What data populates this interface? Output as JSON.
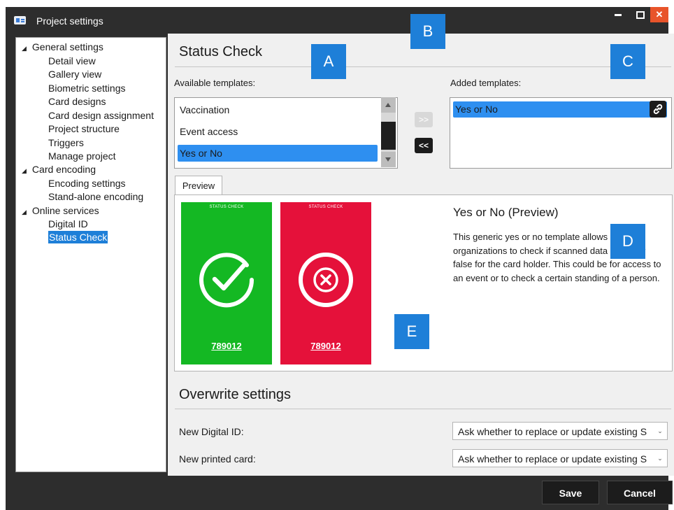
{
  "window": {
    "title": "Project settings",
    "controls": {
      "minimize": "",
      "maximize": "",
      "close": "✕"
    }
  },
  "sidebar": {
    "items": [
      {
        "label": "General settings",
        "level": 0,
        "expanded": true
      },
      {
        "label": "Detail view",
        "level": 1
      },
      {
        "label": "Gallery view",
        "level": 1
      },
      {
        "label": "Biometric settings",
        "level": 1
      },
      {
        "label": "Card designs",
        "level": 1
      },
      {
        "label": "Card design assignment",
        "level": 1
      },
      {
        "label": "Project structure",
        "level": 1
      },
      {
        "label": "Triggers",
        "level": 1
      },
      {
        "label": "Manage project",
        "level": 1
      },
      {
        "label": "Card encoding",
        "level": 0,
        "expanded": true
      },
      {
        "label": "Encoding settings",
        "level": 1
      },
      {
        "label": "Stand-alone encoding",
        "level": 1
      },
      {
        "label": "Online services",
        "level": 0,
        "expanded": true
      },
      {
        "label": "Digital ID",
        "level": 1
      },
      {
        "label": "Status Check",
        "level": 1,
        "selected": true
      }
    ]
  },
  "main": {
    "section_title": "Status Check",
    "available_label": "Available templates:",
    "available_templates": [
      "Vaccination",
      "Event access",
      "Yes or No"
    ],
    "available_selected": "Yes or No",
    "added_label": "Added templates:",
    "added_templates": [
      "Yes or No"
    ],
    "add_button": ">>",
    "remove_button": "<<",
    "preview_tab": "Preview",
    "preview": {
      "title": "Yes or No (Preview)",
      "description": "This generic yes or no template allows organizations to check if scanned data is true or false for the card holder. This could be for access to an event or to check a certain standing of a person.",
      "card_logo": "STATUS CHECK",
      "green_card_code": "789012",
      "red_card_code": "789012"
    },
    "overwrite_title": "Overwrite settings",
    "overwrite_rows": [
      {
        "label": "New Digital ID:",
        "value": "Ask whether to replace or update existing S"
      },
      {
        "label": "New printed card:",
        "value": "Ask whether to replace or update existing S"
      }
    ]
  },
  "callouts": [
    "A",
    "B",
    "C",
    "D",
    "E"
  ],
  "footer": {
    "save_label": "Save",
    "cancel_label": "Cancel"
  },
  "colors": {
    "window_chrome": "#2d2d2d",
    "selection": "#1e7fd8",
    "list_selection": "#2e8ff0",
    "close_button": "#e8542a",
    "green_card": "#14b823",
    "red_card": "#e5113a",
    "callout": "#1e7fd8"
  },
  "icons": {
    "app": "id-card-icon",
    "link": "link-icon",
    "check": "check-circle-icon",
    "cross": "x-circle-icon",
    "scroll_up": "triangle-up-icon",
    "scroll_down": "triangle-down-icon",
    "dropdown": "chevron-down-icon"
  }
}
